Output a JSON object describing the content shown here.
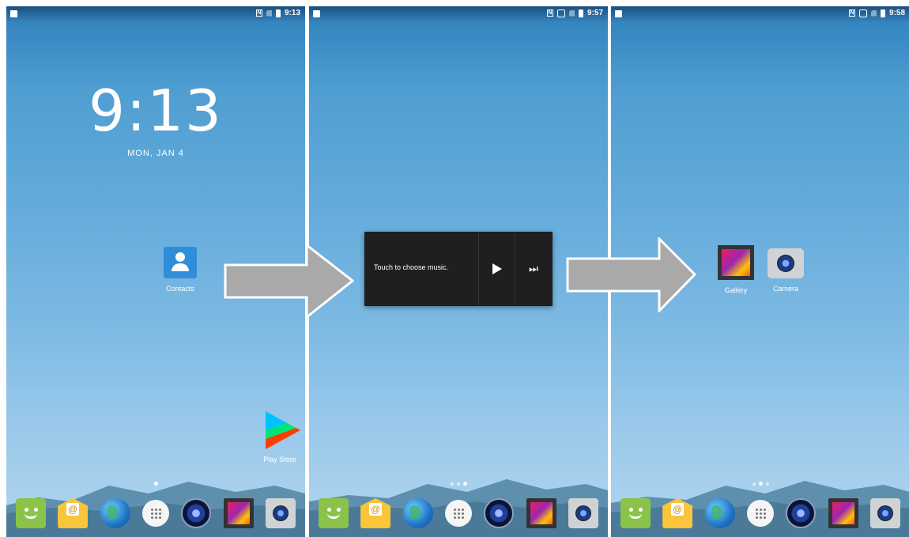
{
  "screens": [
    {
      "status_time": "9:13",
      "clock": "9:13",
      "date": "MON, JAN 4",
      "apps": {
        "contacts": "Contacts",
        "play_store": "Play Store"
      }
    },
    {
      "status_time": "9:57",
      "music_widget": {
        "text": "Touch to choose music.",
        "play_icon": "play-icon",
        "next_icon": "skip-next-icon"
      }
    },
    {
      "status_time": "9:58",
      "apps": {
        "gallery": "Gallery",
        "camera": "Camera"
      }
    }
  ],
  "dock": [
    "messaging-icon",
    "email-icon",
    "browser-icon",
    "apps-drawer-icon",
    "music-icon",
    "gallery-icon",
    "camera-icon"
  ],
  "colors": {
    "arrow_fill": "#a9a9a9",
    "widget_bg": "#1f1f1f",
    "sky_top": "#2f7fbb",
    "sky_bottom": "#b2d6ef"
  }
}
